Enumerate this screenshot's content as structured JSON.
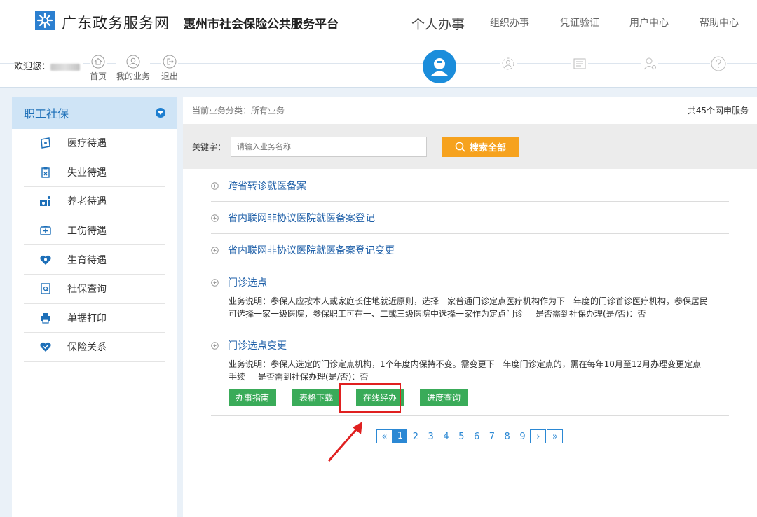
{
  "header": {
    "site_title": "广东政务服务网",
    "platform_title": "惠州市社会保险公共服务平台",
    "nav": [
      "个人办事",
      "组织办事",
      "凭证验证",
      "用户中心",
      "帮助中心"
    ]
  },
  "subbar": {
    "welcome": "欢迎您：",
    "quick": [
      "首页",
      "我的业务",
      "退出"
    ]
  },
  "sidebar": {
    "title": "职工社保",
    "items": [
      "医疗待遇",
      "失业待遇",
      "养老待遇",
      "工伤待遇",
      "生育待遇",
      "社保查询",
      "单据打印",
      "保险关系"
    ]
  },
  "main": {
    "category": "当前业务分类：所有业务",
    "total": "共45个网申服务",
    "keyword_label": "关键字：",
    "search_placeholder": "请输入业务名称",
    "search_button": "搜索全部",
    "services": [
      {
        "title": "跨省转诊就医备案"
      },
      {
        "title": "省内联网非协议医院就医备案登记"
      },
      {
        "title": "省内联网非协议医院就医备案登记变更"
      },
      {
        "title": "门诊选点",
        "desc": "业务说明：参保人应按本人或家庭长住地就近原则，选择一家普通门诊定点医疗机构作为下一年度的门诊首诊医疗机构，参保居民可选择一家一级医院，参保职工可在一、二或三级医院中选择一家作为定点门诊",
        "req": "是否需到社保办理(是/否)：否"
      },
      {
        "title": "门诊选点变更",
        "desc": "业务说明：参保人选定的门诊定点机构，1个年度内保持不变。需变更下一年度门诊定点的，需在每年10月至12月办理变更定点手续",
        "req": "是否需到社保办理(是/否)：否",
        "buttons": [
          "办事指南",
          "表格下载",
          "在线经办",
          "进度查询"
        ]
      }
    ]
  },
  "pagination": {
    "prev": "«",
    "next": "›",
    "last": "»",
    "pages": [
      "1",
      "2",
      "3",
      "4",
      "5",
      "6",
      "7",
      "8",
      "9"
    ],
    "current": "1"
  },
  "colors": {
    "accent_blue": "#1d7ed0",
    "link_blue": "#1e5fa8",
    "search_orange": "#f6a21e",
    "action_green": "#3aab59",
    "highlight_red": "#e02020"
  }
}
